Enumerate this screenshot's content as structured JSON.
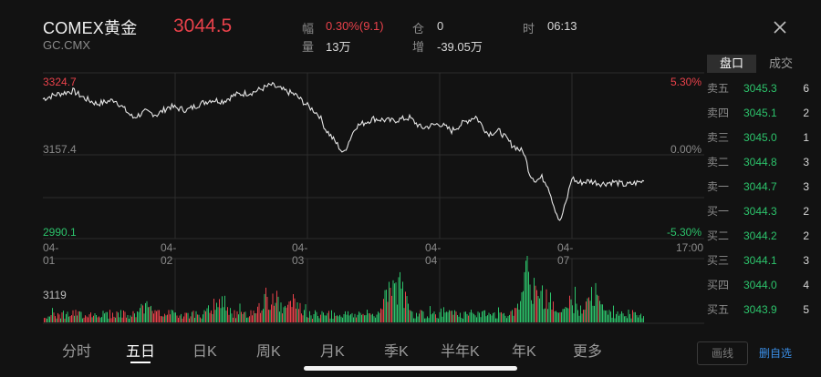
{
  "instrument": {
    "name": "COMEX黄金",
    "code": "GC.CMX",
    "price": "3044.5"
  },
  "stats": [
    {
      "key": "幅",
      "value": "0.30%(9.1)",
      "red": true
    },
    {
      "key": "量",
      "value": "13万",
      "red": false
    },
    {
      "key": "仓",
      "value": "0",
      "red": false
    },
    {
      "key": "增",
      "value": "-39.05万",
      "red": false
    },
    {
      "key": "时",
      "value": "06:13",
      "red": false
    }
  ],
  "chart": {
    "price_high": "3324.7",
    "price_mid": "3157.4",
    "price_low": "2990.1",
    "pct_high": "5.30%",
    "pct_mid": "0.00%",
    "pct_low": "-5.30%",
    "x_labels": [
      "04-01",
      "04-02",
      "04-03",
      "04-04",
      "04-07",
      "17:00"
    ],
    "volume_label": "3119",
    "line_color": "#e6e6e6",
    "up_color": "#e8414a",
    "down_color": "#2cc36b"
  },
  "chart_data": {
    "type": "line",
    "title": "",
    "xlabel": "",
    "ylabel": "",
    "x_ticks": [
      "04-01",
      "04-02",
      "04-03",
      "04-04",
      "04-07",
      "17:00"
    ],
    "ylim": [
      2990.1,
      3324.7
    ],
    "series": [
      {
        "x": [
          0,
          0.02,
          0.05,
          0.07,
          0.09,
          0.12,
          0.15,
          0.17,
          0.19,
          0.21,
          0.24,
          0.26,
          0.28,
          0.3,
          0.32,
          0.35,
          0.38,
          0.4,
          0.42,
          0.44,
          0.45,
          0.46,
          0.47,
          0.49,
          0.5,
          0.52,
          0.55,
          0.58,
          0.61,
          0.63,
          0.66,
          0.68,
          0.7,
          0.72,
          0.74,
          0.76,
          0.78,
          0.8,
          0.81,
          0.82,
          0.83,
          0.84,
          0.85,
          0.86,
          0.87,
          0.88,
          0.89,
          0.91,
          0.93,
          0.95,
          0.97,
          1.0
        ],
        "values": [
          3287,
          3296,
          3305,
          3288,
          3276,
          3285,
          3245,
          3258,
          3252,
          3270,
          3262,
          3275,
          3285,
          3282,
          3296,
          3302,
          3318,
          3306,
          3296,
          3272,
          3262,
          3250,
          3220,
          3185,
          3165,
          3225,
          3243,
          3238,
          3245,
          3222,
          3232,
          3216,
          3234,
          3248,
          3210,
          3215,
          3185,
          3168,
          3120,
          3105,
          3112,
          3095,
          3050,
          3012,
          3055,
          3112,
          3100,
          3104,
          3098,
          3102,
          3095,
          3104
        ]
      }
    ]
  },
  "order_book": {
    "tabs": [
      "盘口",
      "成交"
    ],
    "rows": [
      {
        "name": "卖五",
        "price": "3045.3",
        "qty": "6"
      },
      {
        "name": "卖四",
        "price": "3045.1",
        "qty": "2"
      },
      {
        "name": "卖三",
        "price": "3045.0",
        "qty": "1"
      },
      {
        "name": "卖二",
        "price": "3044.8",
        "qty": "3"
      },
      {
        "name": "卖一",
        "price": "3044.7",
        "qty": "3"
      },
      {
        "name": "买一",
        "price": "3044.3",
        "qty": "2"
      },
      {
        "name": "买二",
        "price": "3044.2",
        "qty": "2"
      },
      {
        "name": "买三",
        "price": "3044.1",
        "qty": "3"
      },
      {
        "name": "买四",
        "price": "3044.0",
        "qty": "4"
      },
      {
        "name": "买五",
        "price": "3043.9",
        "qty": "5"
      }
    ]
  },
  "nav": {
    "items": [
      "分时",
      "五日",
      "日K",
      "周K",
      "月K",
      "季K",
      "半年K",
      "年K",
      "更多"
    ],
    "active": "五日",
    "draw_label": "画线",
    "watch_label": "删自选"
  }
}
